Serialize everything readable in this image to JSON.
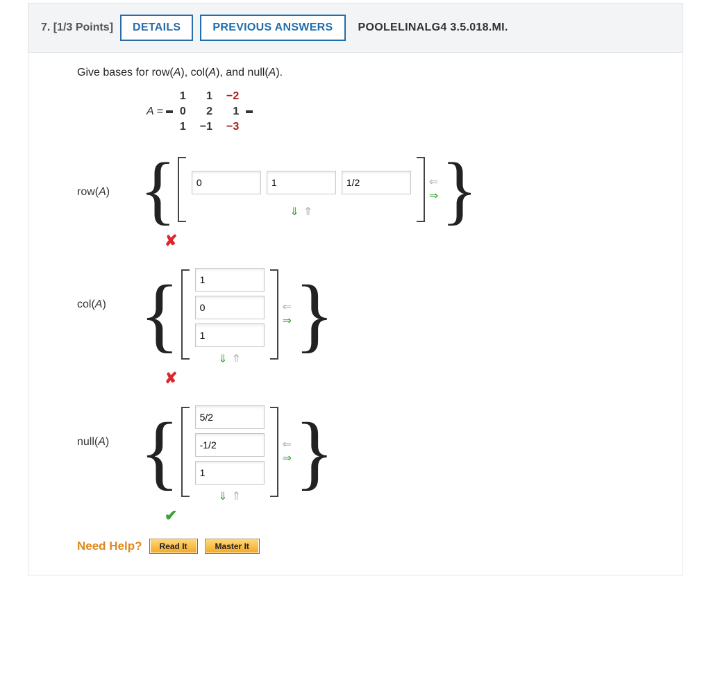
{
  "header": {
    "num": "7.",
    "points": "[1/3 Points]",
    "details": "DETAILS",
    "previous": "PREVIOUS ANSWERS",
    "source": "POOLELINALG4 3.5.018.MI."
  },
  "prompt": "Give bases for row(A), col(A), and null(A).",
  "matrix": {
    "label": "A =",
    "r1c1": "1",
    "r1c2": "1",
    "r1c3": "−2",
    "r2c1": "0",
    "r2c2": "2",
    "r2c3": "1",
    "r3c1": "1",
    "r3c2": "−1",
    "r3c3": "−3"
  },
  "rowA": {
    "label": "row(A)",
    "v1": "0",
    "v2": "1",
    "v3": "1/2"
  },
  "colA": {
    "label": "col(A)",
    "v1": "1",
    "v2": "0",
    "v3": "1"
  },
  "nullA": {
    "label": "null(A)",
    "v1": "5/2",
    "v2": "-1/2",
    "v3": "1"
  },
  "help": {
    "need": "Need Help?",
    "read": "Read It",
    "master": "Master It"
  },
  "icons": {
    "left": "⇐",
    "right": "⇒",
    "down": "⇓",
    "up": "⇑",
    "wrong": "✘",
    "check": "✔"
  }
}
